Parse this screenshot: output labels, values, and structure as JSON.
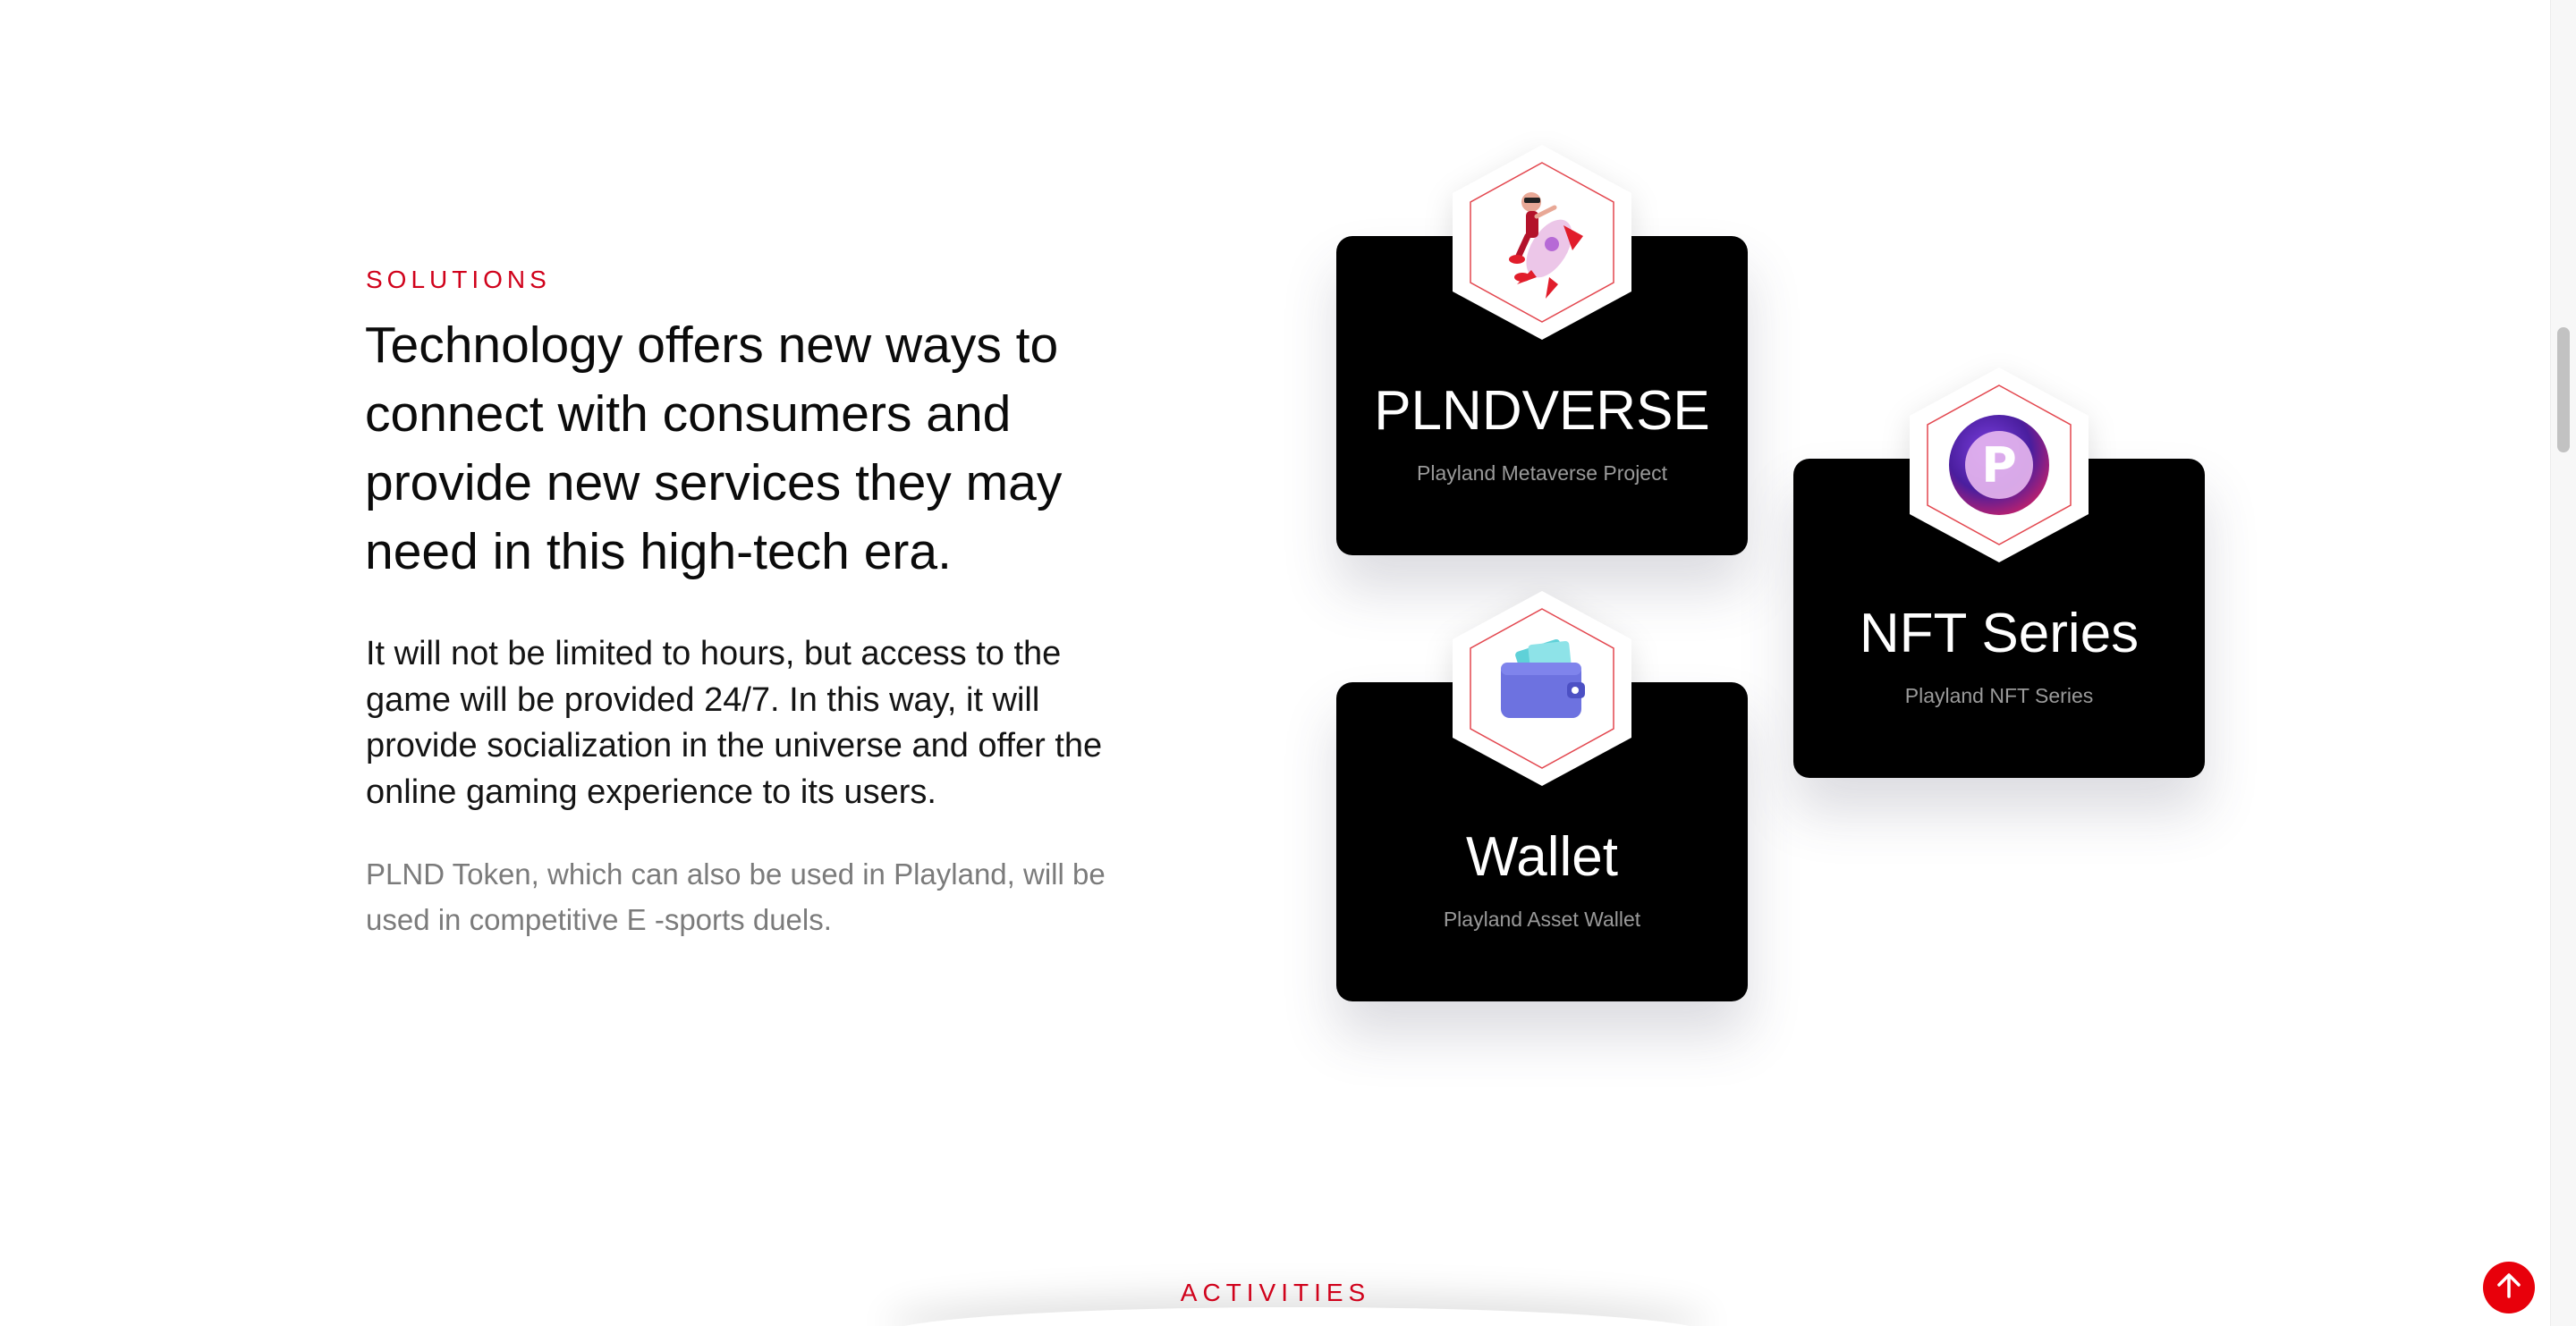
{
  "solutions": {
    "eyebrow": "SOLUTIONS",
    "headline": "Technology offers new ways to connect with consumers and provide new services they may need in this high-tech era.",
    "paragraph": "It will not be limited to hours, but access to the game will be provided 24/7. In this way, it will provide socialization in the universe and offer the online gaming experience to its users.",
    "muted": "PLND Token, which can also be used in Playland, will be used in competitive E -sports duels."
  },
  "cards": [
    {
      "title": "PLNDVERSE",
      "subtitle": "Playland Metaverse Project",
      "icon": "astronaut-rocket-icon"
    },
    {
      "title": "NFT Series",
      "subtitle": "Playland NFT Series",
      "icon": "playland-coin-icon"
    },
    {
      "title": "Wallet",
      "subtitle": "Playland Asset Wallet",
      "icon": "wallet-icon"
    }
  ],
  "activities": {
    "label": "ACTIVITIES"
  },
  "scroll_top": {
    "icon": "arrow-up-icon"
  },
  "colors": {
    "accent": "#d0021b",
    "card_bg": "#000000",
    "button": "#e8000b"
  }
}
